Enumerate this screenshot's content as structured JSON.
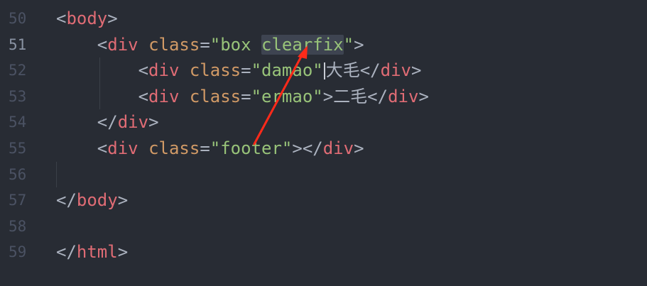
{
  "editor": {
    "line_numbers": [
      "50",
      "51",
      "52",
      "53",
      "54",
      "55",
      "56",
      "57",
      "58",
      "59"
    ],
    "active_line": "51",
    "lines": {
      "l50": {
        "lt": "<",
        "tag": "body",
        "gt": ">"
      },
      "l51": {
        "lt": "<",
        "tag": "div",
        "attr": "class",
        "eq": "=",
        "q1": "\"",
        "val_a": "box ",
        "val_sel": "clearfix",
        "q2": "\"",
        "gt": ">"
      },
      "l52": {
        "lt": "<",
        "tag": "div",
        "attr": "class",
        "eq": "=",
        "q1": "\"",
        "val": "damao",
        "q2": "\"",
        "gt": ">",
        "text": "大毛",
        "close_lt": "</",
        "close_tag": "div",
        "close_gt": ">"
      },
      "l53": {
        "lt": "<",
        "tag": "div",
        "attr": "class",
        "eq": "=",
        "q1": "\"",
        "val": "ermao",
        "q2": "\"",
        "gt": ">",
        "text": "二毛",
        "close_lt": "</",
        "close_tag": "div",
        "close_gt": ">"
      },
      "l54": {
        "close_lt": "</",
        "close_tag": "div",
        "close_gt": ">"
      },
      "l55": {
        "lt": "<",
        "tag": "div",
        "attr": "class",
        "eq": "=",
        "q1": "\"",
        "val": "footer",
        "q2": "\"",
        "gt": ">",
        "close_lt": "</",
        "close_tag": "div",
        "close_gt": ">"
      },
      "l57": {
        "close_lt": "</",
        "close_tag": "body",
        "close_gt": ">"
      },
      "l59": {
        "close_lt": "</",
        "close_tag": "html",
        "close_gt": ">"
      }
    },
    "colors": {
      "background": "#282c34",
      "tag": "#e06c75",
      "attribute": "#d19a66",
      "string": "#98c379",
      "selection": "#3e4451",
      "annotation_arrow": "#ff2a1a"
    },
    "annotation": "red-arrow-icon"
  }
}
